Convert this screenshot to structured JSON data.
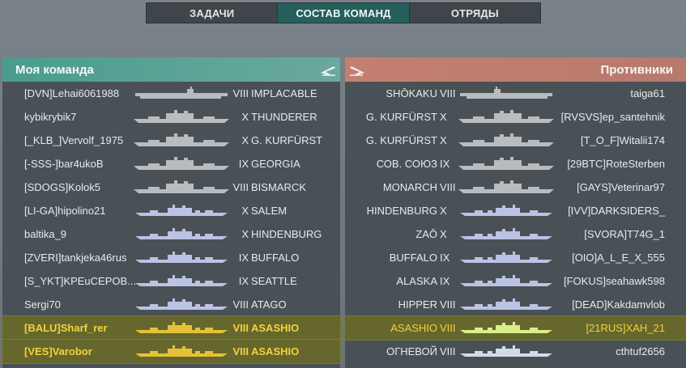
{
  "tabs": [
    {
      "label": "ЗАДАЧИ"
    },
    {
      "label": "СОСТАВ КОМАНД"
    },
    {
      "label": "ОТРЯДЫ"
    }
  ],
  "colors": {
    "battleship": "#b9bcbf",
    "cruiser": "#bac3e4",
    "destroyer_ally": "#e3c23a",
    "destroyer_enemy": "#d9ef8a",
    "cruiser_enemy": "#d2dbe8"
  },
  "my_team": {
    "title": "Моя команда",
    "icon": "carrier-plane-icon",
    "rows": [
      {
        "player": "[DVN]Lehai6061988",
        "tier": "VIII",
        "ship": "IMPLACABLE",
        "type": "carrier",
        "highlight": false
      },
      {
        "player": "kybikrybik7",
        "tier": "X",
        "ship": "THUNDERER",
        "type": "battleship",
        "highlight": false
      },
      {
        "player": "[_KLB_]Vervolf_1975",
        "tier": "X",
        "ship": "G. KURFÜRST",
        "type": "battleship",
        "highlight": false
      },
      {
        "player": "[-SSS-]bar4ukoB",
        "tier": "IX",
        "ship": "GEORGIA",
        "type": "battleship",
        "highlight": false
      },
      {
        "player": "[SDOGS]Kolok5",
        "tier": "VIII",
        "ship": "BISMARCK",
        "type": "battleship",
        "highlight": false
      },
      {
        "player": "[LI-GA]hipolino21",
        "tier": "X",
        "ship": "SALEM",
        "type": "cruiser",
        "highlight": false
      },
      {
        "player": "baltika_9",
        "tier": "X",
        "ship": "HINDENBURG",
        "type": "cruiser",
        "highlight": false
      },
      {
        "player": "[ZVERI]tankjeka46rus",
        "tier": "IX",
        "ship": "BUFFALO",
        "type": "cruiser",
        "highlight": false
      },
      {
        "player": "[S_YKT]KPEuCEPOB...",
        "tier": "IX",
        "ship": "SEATTLE",
        "type": "cruiser",
        "highlight": false
      },
      {
        "player": "Sergi70",
        "tier": "VIII",
        "ship": "ATAGO",
        "type": "cruiser",
        "highlight": false
      },
      {
        "player": "[BALU]Sharf_rer",
        "tier": "VIII",
        "ship": "ASASHIO",
        "type": "destroyer",
        "highlight": true
      },
      {
        "player": "[VES]Varobor",
        "tier": "VIII",
        "ship": "ASASHIO",
        "type": "destroyer",
        "highlight": true
      }
    ]
  },
  "enemy_team": {
    "title": "Противники",
    "icon": "carrier-plane-icon",
    "rows": [
      {
        "player": "taiga61",
        "tier": "VIII",
        "ship": "SHŌKAKU",
        "type": "carrier",
        "highlight": false
      },
      {
        "player": "[RVSVS]ep_santehnik",
        "tier": "X",
        "ship": "G. KURFÜRST",
        "type": "battleship",
        "highlight": false
      },
      {
        "player": "[T_O_F]Witalii174",
        "tier": "X",
        "ship": "G. KURFÜRST",
        "type": "battleship",
        "highlight": false
      },
      {
        "player": "[29BTC]RoteSterben",
        "tier": "IX",
        "ship": "СОВ. СОЮЗ",
        "type": "battleship",
        "highlight": false
      },
      {
        "player": "[GAYS]Veterinar97",
        "tier": "VIII",
        "ship": "MONARCH",
        "type": "battleship",
        "highlight": false
      },
      {
        "player": "[IVV]DARKSIDERS_",
        "tier": "X",
        "ship": "HINDENBURG",
        "type": "cruiser",
        "highlight": false
      },
      {
        "player": "[SVORA]T74G_1",
        "tier": "X",
        "ship": "ZAŌ",
        "type": "cruiser",
        "highlight": false
      },
      {
        "player": "[OIO]A_L_E_X_555",
        "tier": "IX",
        "ship": "BUFFALO",
        "type": "cruiser",
        "highlight": false
      },
      {
        "player": "[FOKUS]seahawk598",
        "tier": "IX",
        "ship": "ALASKA",
        "type": "cruiser",
        "highlight": false
      },
      {
        "player": "[DEAD]Kakdamvlob",
        "tier": "VIII",
        "ship": "HIPPER",
        "type": "cruiser",
        "highlight": false
      },
      {
        "player": "[21RUS]XAH_21",
        "tier": "VIII",
        "ship": "ASASHIO",
        "type": "destroyer",
        "highlight": true
      },
      {
        "player": "cthtuf2656",
        "tier": "VIII",
        "ship": "ОГНЕВОЙ",
        "type": "destroyer-white",
        "highlight": false
      }
    ]
  }
}
